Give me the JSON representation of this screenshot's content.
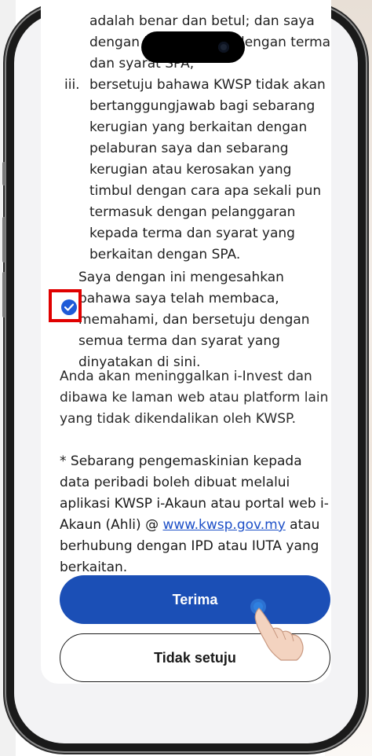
{
  "terms": {
    "continued_lines": [
      "adalah benar dan betul; dan saya",
      "dengan ini                  dengan terma",
      "dan syarat SPA;"
    ],
    "item_iii": {
      "num": "iii.",
      "text": "bersetuju bahawa KWSP tidak akan bertanggungjawab bagi sebarang kerugian yang berkaitan dengan pelaburan saya dan sebarang kerugian atau kerosakan yang timbul dengan cara apa sekali pun termasuk dengan pelanggaran kepada terma dan syarat yang berkaitan dengan SPA."
    }
  },
  "consent": {
    "checked": true,
    "text": "Saya dengan ini mengesahkan bahawa saya telah membaca, memahami, dan bersetuju dengan semua terma dan syarat yang dinyatakan di sini."
  },
  "notice": "Anda akan meninggalkan i-Invest dan dibawa ke laman web atau platform lain yang tidak dikendalikan oleh KWSP.",
  "update_note": {
    "before": "* Sebarang pengemaskinian kepada data peribadi boleh dibuat melalui aplikasi KWSP i-Akaun atau portal web i-Akaun (Ahli) @ ",
    "link": "www.kwsp.gov.my",
    "after": " atau berhubung dengan IPD atau IUTA yang berkaitan."
  },
  "buttons": {
    "accept": "Terima",
    "decline": "Tidak setuju"
  },
  "colors": {
    "primary": "#1b4fb6",
    "check": "#1e5bd8",
    "highlight": "#e00000",
    "link": "#1e50c8"
  }
}
